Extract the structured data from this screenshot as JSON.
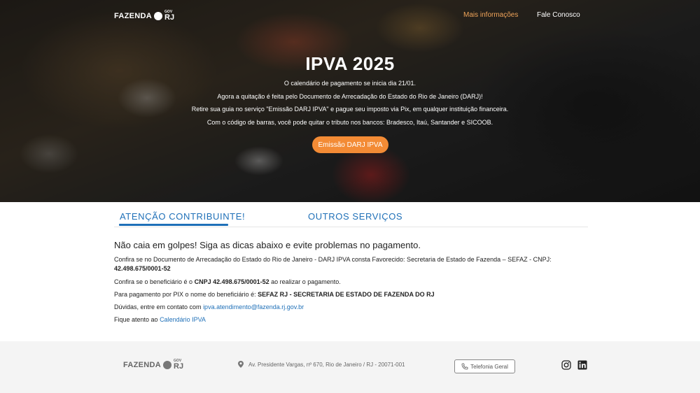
{
  "brand": {
    "name": "FAZENDA",
    "gov": "GOV",
    "state": "RJ"
  },
  "nav": {
    "more_info": "Mais informações",
    "contact": "Fale Conosco"
  },
  "hero": {
    "title": "IPVA 2025",
    "lines": [
      "O calendário de pagamento se inicia dia 21/01.",
      "Agora a quitação é feita pelo Documento de Arrecadação do Estado do Rio de Janeiro (DARJ)!",
      "Retire sua guia no serviço \"Emissão DARJ IPVA\" e pague seu imposto via Pix, em qualquer instituição financeira.",
      "Com o código de barras, você pode quitar o tributo nos bancos: Bradesco, Itaú, Santander e SICOOB."
    ],
    "button": "Emissão DARJ IPVA",
    "accent_color": "#f38b35"
  },
  "tabs": [
    {
      "label": "ATENÇÃO CONTRIBUINTE!",
      "active": true
    },
    {
      "label": "OUTROS SERVIÇOS",
      "active": false
    }
  ],
  "content": {
    "heading": "Não caia em golpes! Siga as dicas abaixo e evite problemas no pagamento.",
    "p1_text": "Confira se no Documento de Arrecadação do Estado do Rio de Janeiro - DARJ IPVA consta Favorecido: Secretaria de Estado de Fazenda – SEFAZ - CNPJ:",
    "p1_bold": "42.498.675/0001-52",
    "p2_pre": "Confira se o beneficiário é o ",
    "p2_bold": "CNPJ 42.498.675/0001-52",
    "p2_post": " ao realizar o pagamento.",
    "p3_pre": "Para pagamento por PIX o nome do beneficiário é: ",
    "p3_bold": "SEFAZ RJ - SECRETARIA DE ESTADO DE FAZENDA DO RJ",
    "p4_pre": "Dúvidas, entre em contato com ",
    "p4_link": "ipva.atendimento@fazenda.rj.gov.br",
    "p5_pre": "Fique atento ao ",
    "p5_link": "Calendário IPVA",
    "link_color": "#1f70b8"
  },
  "footer": {
    "address": "Av. Presidente Vargas, nº 670, Rio de Janeiro / RJ - 20071-001",
    "phone_button": "Telefonia Geral",
    "socials": [
      "instagram-icon",
      "linkedin-icon"
    ]
  }
}
